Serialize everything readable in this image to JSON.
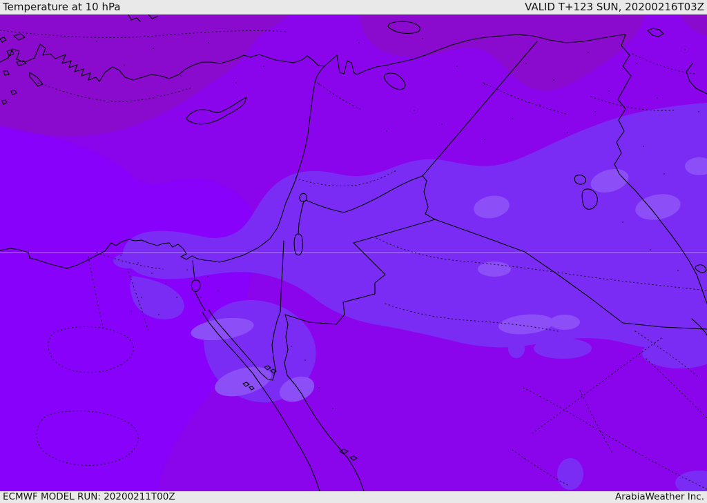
{
  "header": {
    "title": "Temperature at 10 hPa",
    "valid_label": "VALID T+123 SUN, 20200216T03Z"
  },
  "footer": {
    "model_run": "ECMWF MODEL RUN: 20200211T00Z",
    "credit": "ArabiaWeather Inc."
  },
  "colors": {
    "header_bg": "#e9e9e9",
    "header_text": "#141414",
    "map_main": "#8a05ec",
    "map_dark": "#8a0acd",
    "map_bright": "#8701fb",
    "map_band": "#7a2cf4",
    "map_light": "#8b4ef7",
    "coastline": "#000000",
    "contour": "#1c1033",
    "graticule": "#e8e2f4"
  }
}
